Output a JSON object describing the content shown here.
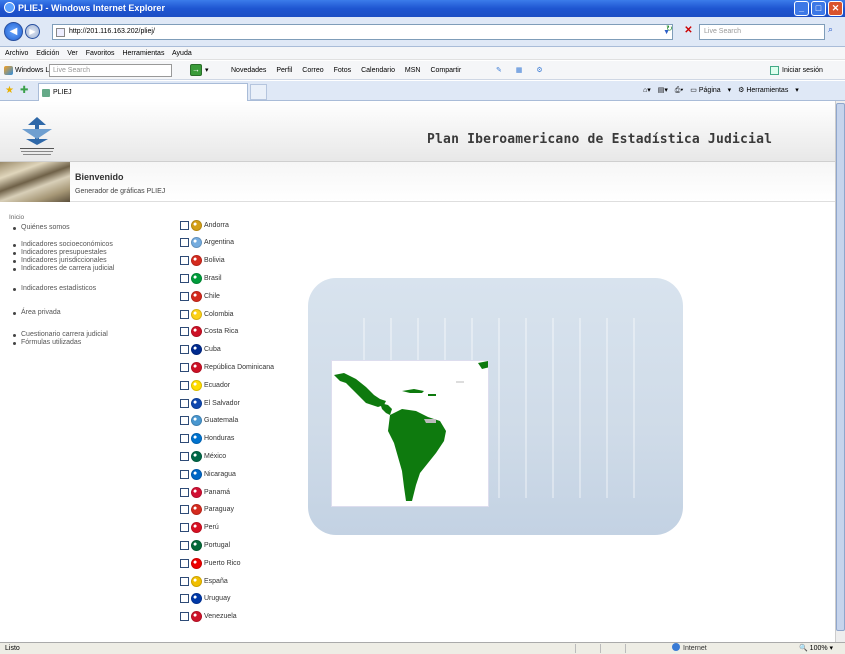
{
  "window": {
    "title": "PLIEJ - Windows Internet Explorer"
  },
  "addressbar": {
    "url": "http://201.116.163.202/pliej/",
    "search_placeholder": "Live Search"
  },
  "menubar": {
    "items": [
      "Archivo",
      "Edición",
      "Ver",
      "Favoritos",
      "Herramientas",
      "Ayuda"
    ]
  },
  "linksbar": {
    "windows_live": "Windows Live",
    "search_placeholder": "Live Search",
    "links": [
      "Novedades",
      "Perfil",
      "Correo",
      "Fotos",
      "Calendario",
      "MSN",
      "Compartir"
    ],
    "signin": "Iniciar sesión"
  },
  "tabsbar": {
    "tab_title": "PLIEJ",
    "commands": [
      "Página",
      "Herramientas"
    ]
  },
  "header": {
    "site_title": "Plan Iberoamericano de Estadística Judicial",
    "logo_caption_1": "CUMBRE JUDICIAL",
    "logo_caption_2": "IBEROAMERICANA"
  },
  "welcome": {
    "title": "Bienvenido",
    "subtitle": "Generador de gráficas PLIEJ"
  },
  "nav": {
    "breadcrumb": "Inicio",
    "group1": [
      "Quiénes somos"
    ],
    "group2": [
      "Indicadores socioeconómicos",
      "Indicadores presupuestales",
      "Indicadores jurisdiccionales",
      "Indicadores de carrera judicial"
    ],
    "group3": [
      "Indicadores estadísticos"
    ],
    "group4": [
      "Área privada"
    ],
    "group5": [
      "Cuestionario carrera judicial",
      "Fórmulas utilizadas"
    ]
  },
  "countries": [
    {
      "name": "Andorra",
      "color": "#d4a017"
    },
    {
      "name": "Argentina",
      "color": "#74acdf"
    },
    {
      "name": "Bolivia",
      "color": "#d52b1e"
    },
    {
      "name": "Brasil",
      "color": "#009c3b"
    },
    {
      "name": "Chile",
      "color": "#d52b1e"
    },
    {
      "name": "Colombia",
      "color": "#fcd116"
    },
    {
      "name": "Costa Rica",
      "color": "#ce1126"
    },
    {
      "name": "Cuba",
      "color": "#002a8f"
    },
    {
      "name": "República Dominicana",
      "color": "#ce1126"
    },
    {
      "name": "Ecuador",
      "color": "#ffdd00"
    },
    {
      "name": "El Salvador",
      "color": "#0f47af"
    },
    {
      "name": "Guatemala",
      "color": "#4997d0"
    },
    {
      "name": "Honduras",
      "color": "#0073cf"
    },
    {
      "name": "México",
      "color": "#006847"
    },
    {
      "name": "Nicaragua",
      "color": "#0067c6"
    },
    {
      "name": "Panamá",
      "color": "#d21034"
    },
    {
      "name": "Paraguay",
      "color": "#d52b1e"
    },
    {
      "name": "Perú",
      "color": "#d91023"
    },
    {
      "name": "Portugal",
      "color": "#046a38"
    },
    {
      "name": "Puerto Rico",
      "color": "#ed0000"
    },
    {
      "name": "España",
      "color": "#f1bf00"
    },
    {
      "name": "Uruguay",
      "color": "#0038a8"
    },
    {
      "name": "Venezuela",
      "color": "#cf142b"
    }
  ],
  "statusbar": {
    "left": "Listo",
    "zone": "Internet",
    "zoom": "100%"
  },
  "colors": {
    "map_land": "#0e7a0e",
    "panel": "#d3dfeb"
  }
}
